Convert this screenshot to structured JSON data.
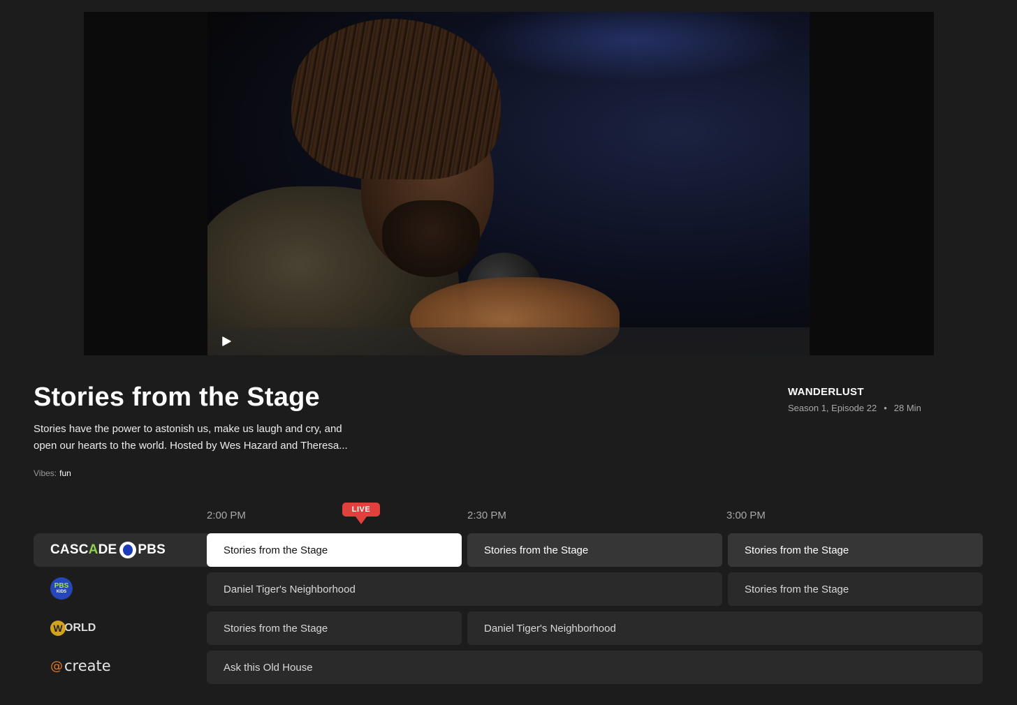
{
  "player": {
    "play_icon": "play-icon"
  },
  "program": {
    "title": "Stories from the Stage",
    "description_line1": "Stories have the power to astonish us, make us laugh and cry, and",
    "description_line2": "open our hearts to the world. Hosted by Wes Hazard and Theresa...",
    "vibes_label": "Vibes:",
    "vibes_value": "fun"
  },
  "meta": {
    "show_name": "WANDERLUST",
    "episode": "Season 1, Episode 22",
    "separator": "•",
    "duration": "28 Min"
  },
  "guide": {
    "live_label": "LIVE",
    "times": [
      "2:00 PM",
      "2:30 PM",
      "3:00 PM"
    ],
    "channels": [
      {
        "logo_text_1": "CASC",
        "logo_text_a": "A",
        "logo_text_2": "DE",
        "logo_text_3": "PBS",
        "programs": [
          "Stories from the Stage",
          "Stories from the Stage",
          "Stories from the Stage"
        ]
      },
      {
        "logo_line1": "PBS",
        "logo_line2": "KIDS",
        "programs": [
          "Daniel Tiger's Neighborhood",
          "Stories from the Stage"
        ]
      },
      {
        "logo_globe": "O",
        "logo_text": "RLD",
        "logo_w": "W",
        "programs": [
          "Stories from the Stage",
          "Daniel Tiger's Neighborhood"
        ]
      },
      {
        "logo_at": "@",
        "logo_text": "create",
        "programs": [
          "Ask this Old House"
        ]
      }
    ]
  },
  "colors": {
    "background": "#1c1c1c",
    "live": "#e2403c",
    "selected_program": "#ffffff"
  }
}
